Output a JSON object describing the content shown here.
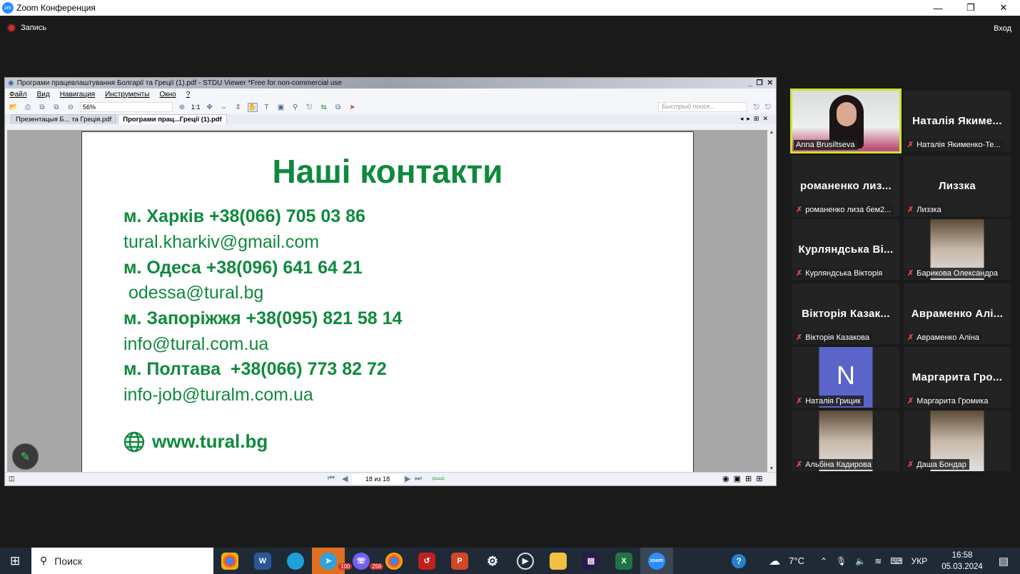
{
  "window": {
    "title": "Zoom Конференция",
    "logo": "zm"
  },
  "meeting": {
    "record_label": "Запись",
    "exit_label": "Вход"
  },
  "viewer": {
    "title": "Програми працевлаштування  Болгарії та Греції (1).pdf - STDU Viewer *Free for non-commercial use",
    "menu": [
      "Файл",
      "Вид",
      "Навигация",
      "Инструменты",
      "Окно",
      "?"
    ],
    "zoom": "56%",
    "fit_label": "1:1",
    "quick_search_placeholder": "Быстрый поиск...",
    "tabs": [
      {
        "label": "Презентацыя Б... та Греція.pdf",
        "active": false
      },
      {
        "label": "Програми прац...Греції (1).pdf",
        "active": true
      }
    ],
    "page_indicator": "18 из 18"
  },
  "slide": {
    "heading": "Наші контакти",
    "lines": [
      {
        "text": "м. Харків +38(066) 705 03 86",
        "bold": true
      },
      {
        "text": "tural.kharkiv@gmail.com",
        "bold": false
      },
      {
        "text": "м. Одеса +38(096) 641 64 21",
        "bold": true
      },
      {
        "text": " odessa@tural.bg",
        "bold": false
      },
      {
        "text": "м. Запоріжжя +38(095) 821 58 14",
        "bold": true
      },
      {
        "text": "info@tural.com.ua",
        "bold": false
      },
      {
        "text": "м. Полтава  +38(066) 773 82 72",
        "bold": true
      },
      {
        "text": "info-job@turalm.com.ua",
        "bold": false
      }
    ],
    "website": "www.tural.bg"
  },
  "participants": [
    {
      "big": "",
      "label": "Anna Brusiltseva",
      "muted": false,
      "video": true,
      "active": true
    },
    {
      "big": "Наталія Якиме...",
      "label": "Наталія Якименко-Те...",
      "muted": true
    },
    {
      "big": "романенко лиз...",
      "label": "романенко лиза бем2...",
      "muted": true
    },
    {
      "big": "Лиззка",
      "label": "Лиззка",
      "muted": true
    },
    {
      "big": "Курляндська Ві...",
      "label": "Курляндська Вікторія",
      "muted": true
    },
    {
      "big": "",
      "label": "Барикова Олександра",
      "muted": true,
      "video": true
    },
    {
      "big": "Вікторія Казак...",
      "label": "Вікторія Казакова",
      "muted": true
    },
    {
      "big": "Авраменко Алі...",
      "label": "Авраменко Аліна",
      "muted": true
    },
    {
      "big": "",
      "label": "Наталія Грицик",
      "muted": true,
      "avatar": "N"
    },
    {
      "big": "Маргарита Гро...",
      "label": "Маргарита Громика",
      "muted": true
    },
    {
      "big": "",
      "label": "Альбіна Кадирова",
      "muted": true,
      "video": true
    },
    {
      "big": "",
      "label": "Даша Бондар",
      "muted": true,
      "video": true
    }
  ],
  "taskbar": {
    "search_label": "Поиск",
    "telegram_badge": "100",
    "viber_badge": "256",
    "temperature": "7°C",
    "language": "УКР",
    "time": "16:58",
    "date": "05.03.2024"
  },
  "colors": {
    "slide_green": "#0f8a3c",
    "active_speaker": "#c8e62e",
    "avatar_bg": "#5b64c8"
  }
}
